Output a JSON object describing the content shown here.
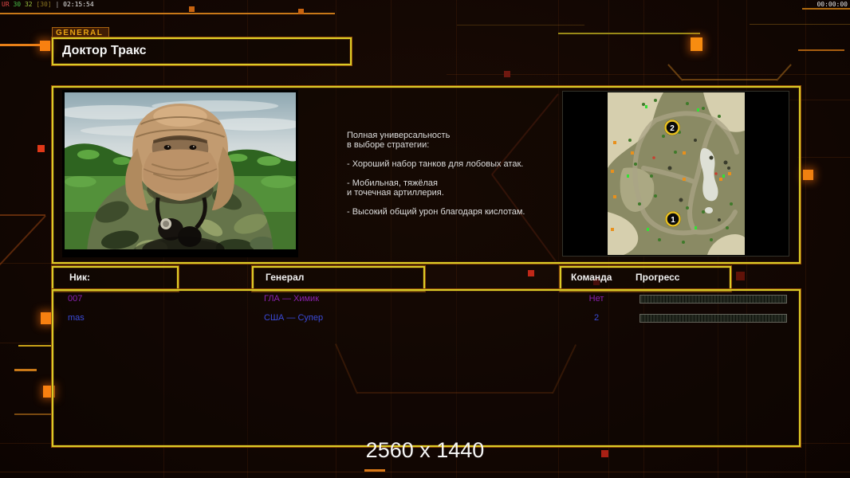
{
  "hud": {
    "stats_left": [
      "UR",
      "30",
      "32",
      "[30]",
      "|",
      "02:15:54"
    ],
    "match_timer": "00:00:00"
  },
  "general_panel": {
    "tab_label": "GENERAL",
    "title": "Доктор Тракс",
    "description_lines": [
      "Полная универсальность",
      "в выборе стратегии:",
      "- Хороший набор танков для лобовых атак.",
      "- Мобильная, тяжёлая",
      "и точечная артиллерия.",
      "- Высокий общий урон благодаря кислотам."
    ]
  },
  "map_preview": {
    "start_markers": [
      "1",
      "2"
    ]
  },
  "players": {
    "headers": {
      "nick": "Ник:",
      "general": "Генерал",
      "team": "Команда",
      "progress": "Прогресс"
    },
    "rows": [
      {
        "nick": "007",
        "general": "ГЛА — Химик",
        "team": "Нет",
        "progress_percent": 0
      },
      {
        "nick": "mas",
        "general": "США — Супер",
        "team": "2",
        "progress_percent": 0
      }
    ]
  },
  "footer": {
    "resolution_label": "2560 x 1440"
  },
  "colors": {
    "panel_border_yellow": "#d9cb27",
    "panel_border_outer_orange": "#8f4a08",
    "accent_square_orange": "#f8820e",
    "accent_square_red": "#c02818",
    "row1_text": "#8a22b0",
    "row2_text": "#3a4ad8",
    "header_text": "#f0f0f0",
    "background": "#130703"
  }
}
